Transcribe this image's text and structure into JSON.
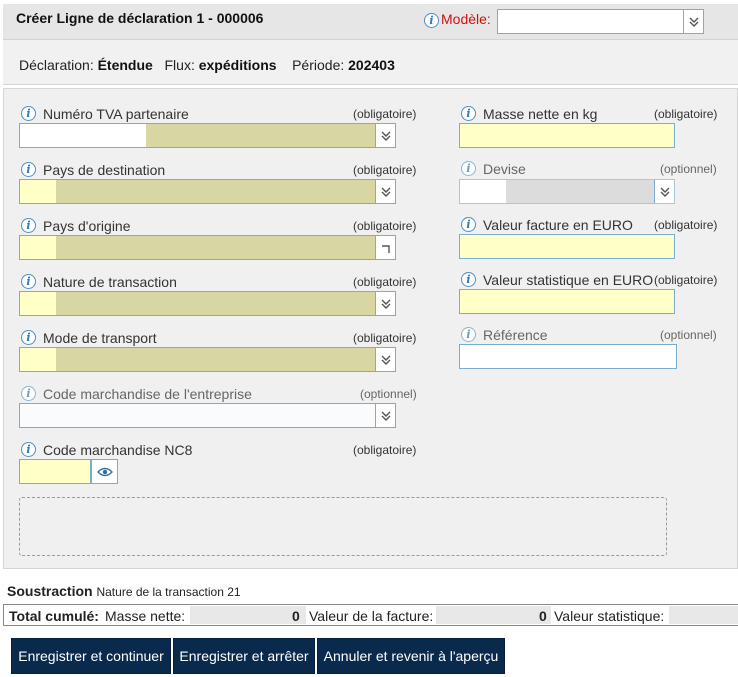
{
  "header": {
    "title": "Créer Ligne de déclaration 1 - 000006",
    "modele_label": "Modèle:",
    "modele_value": ""
  },
  "infobar": {
    "declaration_label": "Déclaration:",
    "declaration_value": "Étendue",
    "flux_label": "Flux:",
    "flux_value": "expéditions",
    "periode_label": "Période:",
    "periode_value": "202403"
  },
  "form": {
    "left": [
      {
        "label": "Numéro TVA partenaire",
        "status": "(obligatoire)",
        "value": ""
      },
      {
        "label": "Pays de destination",
        "status": "(obligatoire)",
        "value": ""
      },
      {
        "label": "Pays d'origine",
        "status": "(obligatoire)",
        "value": ""
      },
      {
        "label": "Nature de transaction",
        "status": "(obligatoire)",
        "value": ""
      },
      {
        "label": "Mode de transport",
        "status": "(obligatoire)",
        "value": ""
      },
      {
        "label": "Code marchandise de l'entreprise",
        "status": "(optionnel)",
        "value": ""
      },
      {
        "label": "Code marchandise NC8",
        "status": "(obligatoire)",
        "value": ""
      }
    ],
    "right": [
      {
        "label": "Masse nette en kg",
        "status": "(obligatoire)",
        "value": ""
      },
      {
        "label": "Devise",
        "status": "(optionnel)",
        "value": ""
      },
      {
        "label": "Valeur facture en EURO",
        "status": "(obligatoire)",
        "value": ""
      },
      {
        "label": "Valeur statistique en EURO",
        "status": "(obligatoire)",
        "value": ""
      },
      {
        "label": "Référence",
        "status": "(optionnel)",
        "value": ""
      }
    ]
  },
  "footer": {
    "soustraction_label": "Soustraction",
    "soustraction_text": "Nature de la transaction 21",
    "total_label": "Total cumulé:",
    "masse_label": "Masse nette:",
    "masse_value": "0",
    "facture_label": "Valeur de la facture:",
    "facture_value": "0",
    "statistique_label": "Valeur statistique:"
  },
  "buttons": {
    "save_continue": "Enregistrer et continuer",
    "save_stop": "Enregistrer et arrêter",
    "cancel": "Annuler et revenir à l'aperçu"
  },
  "colors": {
    "required_field": "#ffffc8",
    "combo_fill": "#d8d7a4",
    "button_bg": "#0a2a4d",
    "modele_label": "#d01010",
    "field_border": "#7aaed1"
  },
  "icons": {
    "info": "info-icon",
    "dropdown": "chevron-double-down-icon",
    "preview": "eye-icon",
    "corner": "corner-arrow-icon"
  }
}
